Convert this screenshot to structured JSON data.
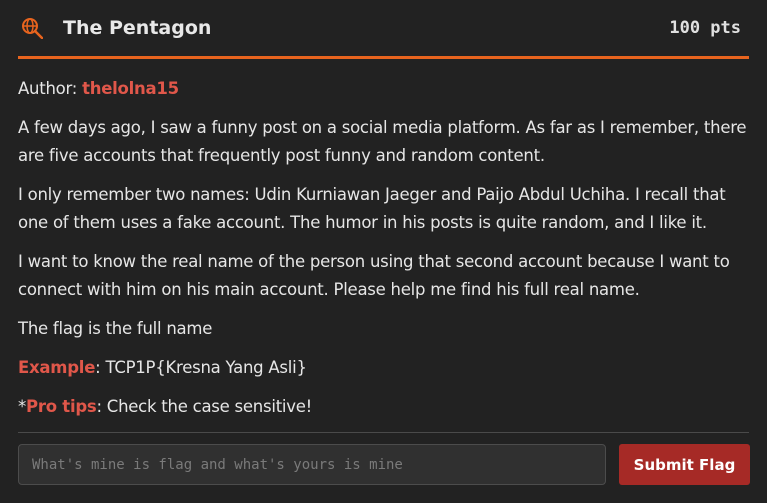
{
  "challenge": {
    "title": "The Pentagon",
    "points": "100 pts",
    "icon": "osint-search-globe-icon",
    "accent_color": "#e8641e",
    "author_label": "Author:",
    "author": "thelolna15",
    "paragraphs": [
      "A few days ago, I saw a funny post on a social media platform. As far as I remember, there are five accounts that frequently post funny and random content.",
      "I only remember two names: Udin Kurniawan Jaeger and Paijo Abdul Uchiha. I recall that one of them uses a fake account. The humor in his posts is quite random, and I like it.",
      "I want to know the real name of the person using that second account because I want to connect with him on his main account. Please help me find his full real name.",
      "The flag is the full name"
    ],
    "example_label": "Example",
    "example_text": ": TCP1P{Kresna Yang Asli}",
    "tips_prefix": "*",
    "tips_label": "Pro tips",
    "tips_text": ": Check the case sensitive!"
  },
  "flag_form": {
    "placeholder": "What's mine is flag and what's yours is mine",
    "value": "",
    "submit_label": "Submit Flag",
    "submit_color": "#a62a26"
  }
}
